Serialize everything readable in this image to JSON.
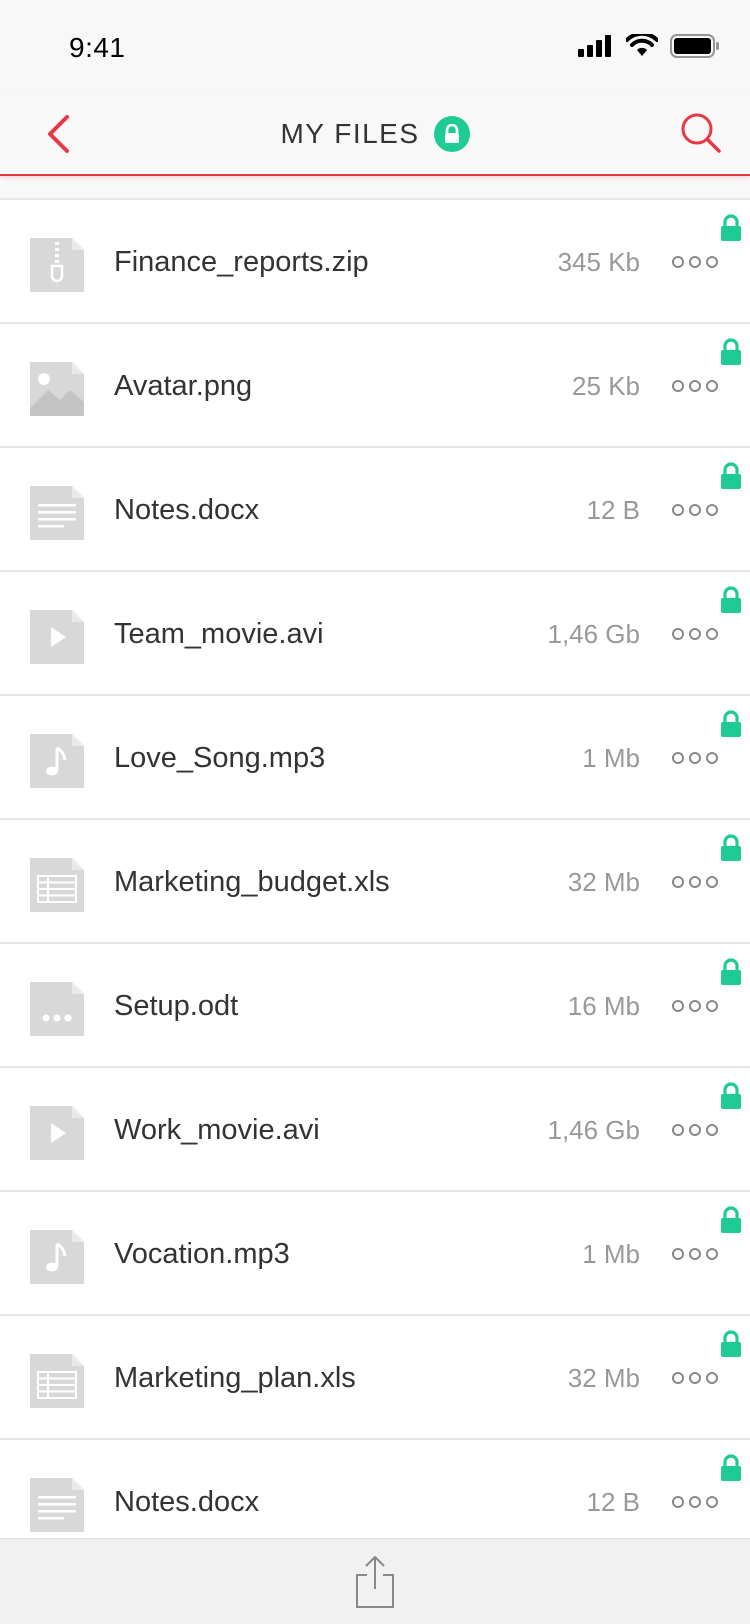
{
  "status_bar": {
    "time": "9:41"
  },
  "header": {
    "title": "MY FILES"
  },
  "colors": {
    "accent": "#e63946",
    "lock": "#1ecb94",
    "icon_gray": "#d8d8d8"
  },
  "files": [
    {
      "name": "Finance_reports.zip",
      "size": "345 Kb",
      "type": "zip",
      "icon": "zip-file-icon"
    },
    {
      "name": "Avatar.png",
      "size": "25 Kb",
      "type": "image",
      "icon": "image-file-icon"
    },
    {
      "name": "Notes.docx",
      "size": "12 B",
      "type": "doc",
      "icon": "document-file-icon"
    },
    {
      "name": "Team_movie.avi",
      "size": "1,46 Gb",
      "type": "video",
      "icon": "video-file-icon"
    },
    {
      "name": "Love_Song.mp3",
      "size": "1 Mb",
      "type": "audio",
      "icon": "audio-file-icon"
    },
    {
      "name": "Marketing_budget.xls",
      "size": "32 Mb",
      "type": "sheet",
      "icon": "spreadsheet-file-icon"
    },
    {
      "name": "Setup.odt",
      "size": "16 Mb",
      "type": "other",
      "icon": "generic-file-icon"
    },
    {
      "name": "Work_movie.avi",
      "size": "1,46 Gb",
      "type": "video",
      "icon": "video-file-icon"
    },
    {
      "name": "Vocation.mp3",
      "size": "1 Mb",
      "type": "audio",
      "icon": "audio-file-icon"
    },
    {
      "name": "Marketing_plan.xls",
      "size": "32 Mb",
      "type": "sheet",
      "icon": "spreadsheet-file-icon"
    },
    {
      "name": "Notes.docx",
      "size": "12 B",
      "type": "doc",
      "icon": "document-file-icon"
    }
  ]
}
